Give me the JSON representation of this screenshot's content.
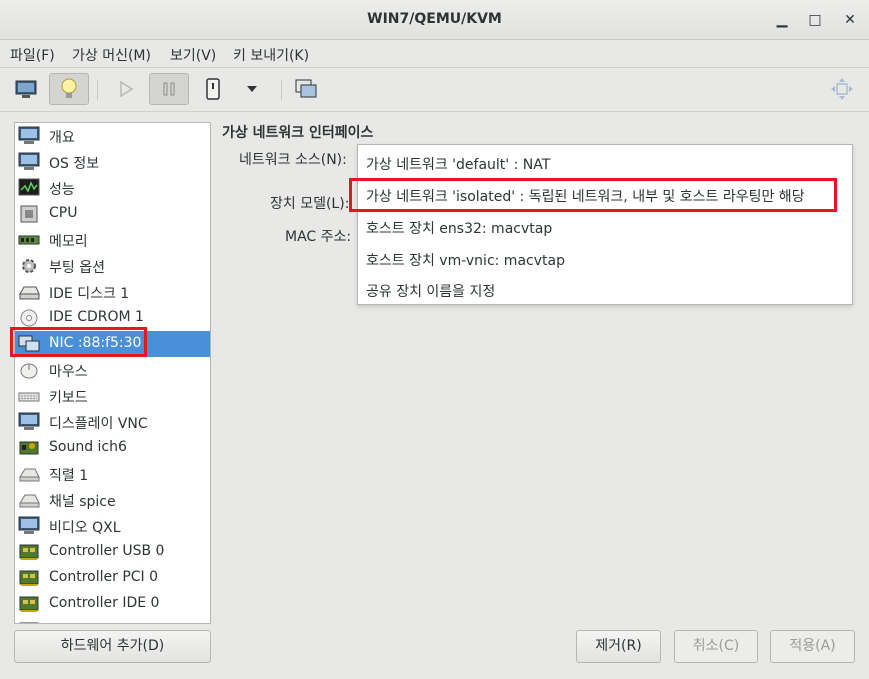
{
  "window": {
    "title": "WIN7/QEMU/KVM",
    "minimize_glyph": "▁",
    "maximize_glyph": "□",
    "close_glyph": "✕"
  },
  "menubar": {
    "items": [
      "파일(F)",
      "가상 머신(M)",
      "보기(V)",
      "키 보내기(K)"
    ]
  },
  "sidebar": {
    "items": [
      {
        "label": "개요",
        "icon": "monitor-icon"
      },
      {
        "label": "OS 정보",
        "icon": "monitor-icon"
      },
      {
        "label": "성능",
        "icon": "performance-icon"
      },
      {
        "label": "CPU",
        "icon": "cpu-icon"
      },
      {
        "label": "메모리",
        "icon": "memory-icon"
      },
      {
        "label": "부팅 옵션",
        "icon": "gear-icon"
      },
      {
        "label": "IDE 디스크 1",
        "icon": "disk-icon"
      },
      {
        "label": "IDE CDROM 1",
        "icon": "cdrom-icon"
      },
      {
        "label": "NIC :88:f5:30",
        "icon": "network-icon"
      },
      {
        "label": "마우스",
        "icon": "mouse-icon"
      },
      {
        "label": "키보드",
        "icon": "keyboard-icon"
      },
      {
        "label": "디스플레이 VNC",
        "icon": "monitor-icon"
      },
      {
        "label": "Sound ich6",
        "icon": "sound-icon"
      },
      {
        "label": "직렬 1",
        "icon": "serial-icon"
      },
      {
        "label": "채널 spice",
        "icon": "serial-icon"
      },
      {
        "label": "비디오 QXL",
        "icon": "monitor-icon"
      },
      {
        "label": "Controller USB 0",
        "icon": "controller-icon"
      },
      {
        "label": "Controller PCI 0",
        "icon": "controller-icon"
      },
      {
        "label": "Controller IDE 0",
        "icon": "controller-icon"
      }
    ],
    "selected_index": 8,
    "add_hardware_label": "하드웨어 추가(D)"
  },
  "details": {
    "title": "가상 네트워크 인터페이스",
    "network_source_label": "네트워크 소스(N):",
    "device_model_label": "장치 모델(L):",
    "mac_label": "MAC 주소:",
    "dropdown_options": [
      "가상 네트워크 'default' : NAT",
      "가상 네트워크 'isolated' : 독립된 네트워크, 내부 및 호스트 라우팅만 해당",
      "호스트 장치 ens32: macvtap",
      "호스트 장치 vm-vnic: macvtap",
      "공유 장치 이름을 지정"
    ]
  },
  "buttons": {
    "remove": "제거(R)",
    "cancel": "취소(C)",
    "apply": "적용(A)"
  },
  "colors": {
    "highlight": "#e4161f",
    "selection": "#4a90d9"
  }
}
